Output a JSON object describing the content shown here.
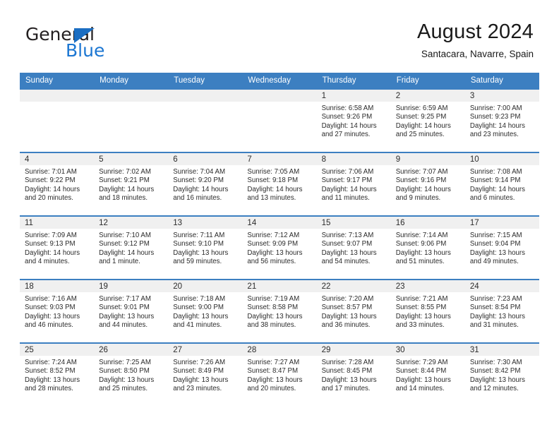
{
  "brand": {
    "name_part1": "General",
    "name_part2": "Blue",
    "accent_color": "#1b76d2",
    "triangle_color": "#1b6ec2"
  },
  "header": {
    "title": "August 2024",
    "subtitle": "Santacara, Navarre, Spain"
  },
  "calendar": {
    "header_bg": "#3c7fc1",
    "weekday_headers": [
      "Sunday",
      "Monday",
      "Tuesday",
      "Wednesday",
      "Thursday",
      "Friday",
      "Saturday"
    ],
    "weeks": [
      [
        {
          "date": "",
          "empty": true,
          "sunrise": "",
          "sunset": "",
          "daylight_line1": "",
          "daylight_line2": ""
        },
        {
          "date": "",
          "empty": true,
          "sunrise": "",
          "sunset": "",
          "daylight_line1": "",
          "daylight_line2": ""
        },
        {
          "date": "",
          "empty": true,
          "sunrise": "",
          "sunset": "",
          "daylight_line1": "",
          "daylight_line2": ""
        },
        {
          "date": "",
          "empty": true,
          "sunrise": "",
          "sunset": "",
          "daylight_line1": "",
          "daylight_line2": ""
        },
        {
          "date": "1",
          "empty": false,
          "sunrise": "Sunrise: 6:58 AM",
          "sunset": "Sunset: 9:26 PM",
          "daylight_line1": "Daylight: 14 hours",
          "daylight_line2": "and 27 minutes."
        },
        {
          "date": "2",
          "empty": false,
          "sunrise": "Sunrise: 6:59 AM",
          "sunset": "Sunset: 9:25 PM",
          "daylight_line1": "Daylight: 14 hours",
          "daylight_line2": "and 25 minutes."
        },
        {
          "date": "3",
          "empty": false,
          "sunrise": "Sunrise: 7:00 AM",
          "sunset": "Sunset: 9:23 PM",
          "daylight_line1": "Daylight: 14 hours",
          "daylight_line2": "and 23 minutes."
        }
      ],
      [
        {
          "date": "4",
          "empty": false,
          "sunrise": "Sunrise: 7:01 AM",
          "sunset": "Sunset: 9:22 PM",
          "daylight_line1": "Daylight: 14 hours",
          "daylight_line2": "and 20 minutes."
        },
        {
          "date": "5",
          "empty": false,
          "sunrise": "Sunrise: 7:02 AM",
          "sunset": "Sunset: 9:21 PM",
          "daylight_line1": "Daylight: 14 hours",
          "daylight_line2": "and 18 minutes."
        },
        {
          "date": "6",
          "empty": false,
          "sunrise": "Sunrise: 7:04 AM",
          "sunset": "Sunset: 9:20 PM",
          "daylight_line1": "Daylight: 14 hours",
          "daylight_line2": "and 16 minutes."
        },
        {
          "date": "7",
          "empty": false,
          "sunrise": "Sunrise: 7:05 AM",
          "sunset": "Sunset: 9:18 PM",
          "daylight_line1": "Daylight: 14 hours",
          "daylight_line2": "and 13 minutes."
        },
        {
          "date": "8",
          "empty": false,
          "sunrise": "Sunrise: 7:06 AM",
          "sunset": "Sunset: 9:17 PM",
          "daylight_line1": "Daylight: 14 hours",
          "daylight_line2": "and 11 minutes."
        },
        {
          "date": "9",
          "empty": false,
          "sunrise": "Sunrise: 7:07 AM",
          "sunset": "Sunset: 9:16 PM",
          "daylight_line1": "Daylight: 14 hours",
          "daylight_line2": "and 9 minutes."
        },
        {
          "date": "10",
          "empty": false,
          "sunrise": "Sunrise: 7:08 AM",
          "sunset": "Sunset: 9:14 PM",
          "daylight_line1": "Daylight: 14 hours",
          "daylight_line2": "and 6 minutes."
        }
      ],
      [
        {
          "date": "11",
          "empty": false,
          "sunrise": "Sunrise: 7:09 AM",
          "sunset": "Sunset: 9:13 PM",
          "daylight_line1": "Daylight: 14 hours",
          "daylight_line2": "and 4 minutes."
        },
        {
          "date": "12",
          "empty": false,
          "sunrise": "Sunrise: 7:10 AM",
          "sunset": "Sunset: 9:12 PM",
          "daylight_line1": "Daylight: 14 hours",
          "daylight_line2": "and 1 minute."
        },
        {
          "date": "13",
          "empty": false,
          "sunrise": "Sunrise: 7:11 AM",
          "sunset": "Sunset: 9:10 PM",
          "daylight_line1": "Daylight: 13 hours",
          "daylight_line2": "and 59 minutes."
        },
        {
          "date": "14",
          "empty": false,
          "sunrise": "Sunrise: 7:12 AM",
          "sunset": "Sunset: 9:09 PM",
          "daylight_line1": "Daylight: 13 hours",
          "daylight_line2": "and 56 minutes."
        },
        {
          "date": "15",
          "empty": false,
          "sunrise": "Sunrise: 7:13 AM",
          "sunset": "Sunset: 9:07 PM",
          "daylight_line1": "Daylight: 13 hours",
          "daylight_line2": "and 54 minutes."
        },
        {
          "date": "16",
          "empty": false,
          "sunrise": "Sunrise: 7:14 AM",
          "sunset": "Sunset: 9:06 PM",
          "daylight_line1": "Daylight: 13 hours",
          "daylight_line2": "and 51 minutes."
        },
        {
          "date": "17",
          "empty": false,
          "sunrise": "Sunrise: 7:15 AM",
          "sunset": "Sunset: 9:04 PM",
          "daylight_line1": "Daylight: 13 hours",
          "daylight_line2": "and 49 minutes."
        }
      ],
      [
        {
          "date": "18",
          "empty": false,
          "sunrise": "Sunrise: 7:16 AM",
          "sunset": "Sunset: 9:03 PM",
          "daylight_line1": "Daylight: 13 hours",
          "daylight_line2": "and 46 minutes."
        },
        {
          "date": "19",
          "empty": false,
          "sunrise": "Sunrise: 7:17 AM",
          "sunset": "Sunset: 9:01 PM",
          "daylight_line1": "Daylight: 13 hours",
          "daylight_line2": "and 44 minutes."
        },
        {
          "date": "20",
          "empty": false,
          "sunrise": "Sunrise: 7:18 AM",
          "sunset": "Sunset: 9:00 PM",
          "daylight_line1": "Daylight: 13 hours",
          "daylight_line2": "and 41 minutes."
        },
        {
          "date": "21",
          "empty": false,
          "sunrise": "Sunrise: 7:19 AM",
          "sunset": "Sunset: 8:58 PM",
          "daylight_line1": "Daylight: 13 hours",
          "daylight_line2": "and 38 minutes."
        },
        {
          "date": "22",
          "empty": false,
          "sunrise": "Sunrise: 7:20 AM",
          "sunset": "Sunset: 8:57 PM",
          "daylight_line1": "Daylight: 13 hours",
          "daylight_line2": "and 36 minutes."
        },
        {
          "date": "23",
          "empty": false,
          "sunrise": "Sunrise: 7:21 AM",
          "sunset": "Sunset: 8:55 PM",
          "daylight_line1": "Daylight: 13 hours",
          "daylight_line2": "and 33 minutes."
        },
        {
          "date": "24",
          "empty": false,
          "sunrise": "Sunrise: 7:23 AM",
          "sunset": "Sunset: 8:54 PM",
          "daylight_line1": "Daylight: 13 hours",
          "daylight_line2": "and 31 minutes."
        }
      ],
      [
        {
          "date": "25",
          "empty": false,
          "sunrise": "Sunrise: 7:24 AM",
          "sunset": "Sunset: 8:52 PM",
          "daylight_line1": "Daylight: 13 hours",
          "daylight_line2": "and 28 minutes."
        },
        {
          "date": "26",
          "empty": false,
          "sunrise": "Sunrise: 7:25 AM",
          "sunset": "Sunset: 8:50 PM",
          "daylight_line1": "Daylight: 13 hours",
          "daylight_line2": "and 25 minutes."
        },
        {
          "date": "27",
          "empty": false,
          "sunrise": "Sunrise: 7:26 AM",
          "sunset": "Sunset: 8:49 PM",
          "daylight_line1": "Daylight: 13 hours",
          "daylight_line2": "and 23 minutes."
        },
        {
          "date": "28",
          "empty": false,
          "sunrise": "Sunrise: 7:27 AM",
          "sunset": "Sunset: 8:47 PM",
          "daylight_line1": "Daylight: 13 hours",
          "daylight_line2": "and 20 minutes."
        },
        {
          "date": "29",
          "empty": false,
          "sunrise": "Sunrise: 7:28 AM",
          "sunset": "Sunset: 8:45 PM",
          "daylight_line1": "Daylight: 13 hours",
          "daylight_line2": "and 17 minutes."
        },
        {
          "date": "30",
          "empty": false,
          "sunrise": "Sunrise: 7:29 AM",
          "sunset": "Sunset: 8:44 PM",
          "daylight_line1": "Daylight: 13 hours",
          "daylight_line2": "and 14 minutes."
        },
        {
          "date": "31",
          "empty": false,
          "sunrise": "Sunrise: 7:30 AM",
          "sunset": "Sunset: 8:42 PM",
          "daylight_line1": "Daylight: 13 hours",
          "daylight_line2": "and 12 minutes."
        }
      ]
    ]
  }
}
